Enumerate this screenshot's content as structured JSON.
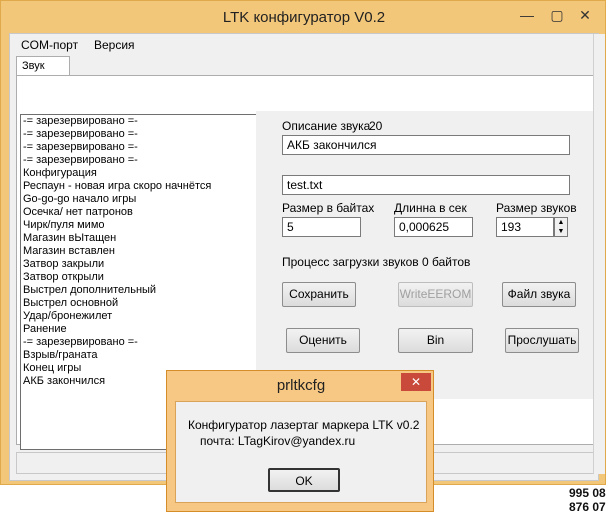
{
  "window": {
    "title": "LTK конфигуратор V0.2",
    "minimize_glyph": "—",
    "maximize_glyph": "▢",
    "close_glyph": "✕"
  },
  "menu": {
    "items": [
      "COM-порт",
      "Версия"
    ]
  },
  "tabs": [
    {
      "label": "Звук"
    }
  ],
  "sound_list": [
    "-= зарезервировано =-",
    "-= зарезервировано =-",
    "-= зарезервировано =-",
    "-= зарезервировано =-",
    "Конфигурация",
    "Респаун - новая игра скоро начнётся",
    "Go-go-go  начало игры",
    "Осечка/ нет патронов",
    "Чирк/пуля мимо",
    "Магазин вЫтащен",
    "Магазин вставлен",
    "Затвор закрыли",
    "Затвор открыли",
    "Выстрел дополнительный",
    "Выстрел основной",
    "Удар/бронежилет",
    "Ранение",
    "-= зарезервировано =-",
    "Взрыв/граната",
    "Конец игры",
    "АКБ закончился"
  ],
  "sound": {
    "description_label": "Описание звука",
    "index": "20",
    "description_value": "АКБ закончился",
    "file_value": "test.txt",
    "size_bytes_label": "Размер в байтах",
    "size_bytes_value": "5",
    "duration_label": "Длинна в сек",
    "duration_value": "0,000625",
    "sounds_size_label": "Размер звуков",
    "sounds_size_value": "193",
    "upload_status": "Процесс загрузки звуков  0 байтов"
  },
  "buttons": {
    "save": "Сохранить",
    "write_eerom": "WriteEEROM",
    "sound_file": "Файл звука",
    "evaluate": "Оценить",
    "bin": "Bin",
    "listen": "Прослушать"
  },
  "dialog": {
    "title": "prltkcfg",
    "close_glyph": "✕",
    "line1": "Конфигуратор лазертаг маркера LTK v0.2",
    "line2": "почта:  LTagKirov@yandex.ru",
    "ok": "OK"
  },
  "background_text": {
    "line1": "995 08",
    "line2": "876 07"
  }
}
